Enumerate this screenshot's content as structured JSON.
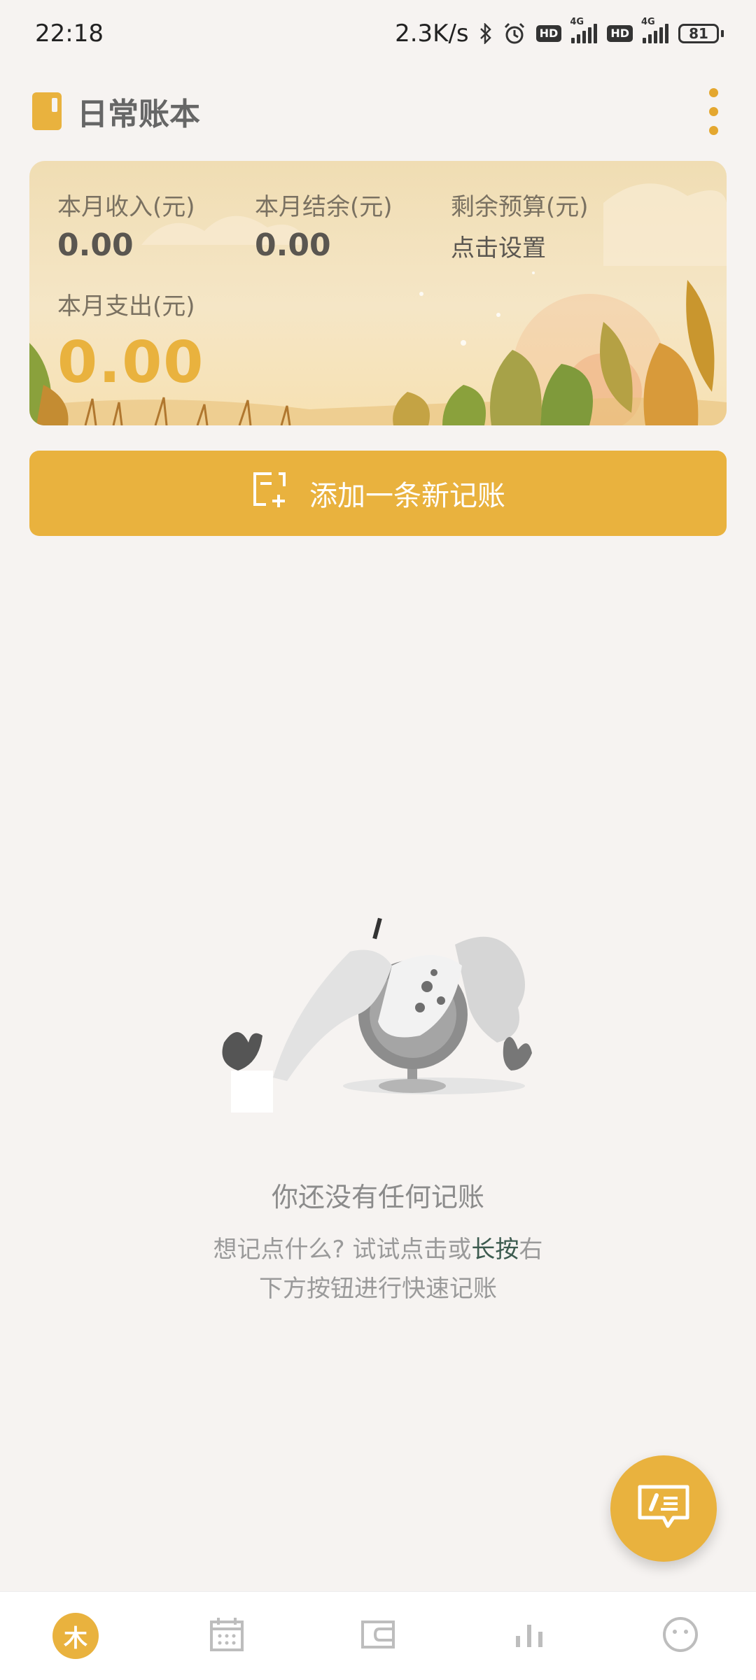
{
  "status_bar": {
    "time": "22:18",
    "net_speed": "2.3K/s",
    "hd": "HD",
    "net_type": "4G",
    "battery": "81"
  },
  "header": {
    "title": "日常账本"
  },
  "summary": {
    "income_label": "本月收入(元)",
    "income_value": "0.00",
    "balance_label": "本月结余(元)",
    "balance_value": "0.00",
    "budget_label": "剩余预算(元)",
    "budget_action": "点击设置",
    "expense_label": "本月支出(元)",
    "expense_value": "0.00"
  },
  "add_button": {
    "label": "添加一条新记账"
  },
  "empty_state": {
    "title": "你还没有任何记账",
    "hint_before": "想记点什么? 试试点击或",
    "hint_highlight": "长按",
    "hint_after": "右",
    "hint_line2": "下方按钮进行快速记账"
  },
  "bottom_nav": {
    "home_glyph": "木"
  },
  "colors": {
    "accent": "#e9b23e",
    "background": "#f6f3f1"
  }
}
